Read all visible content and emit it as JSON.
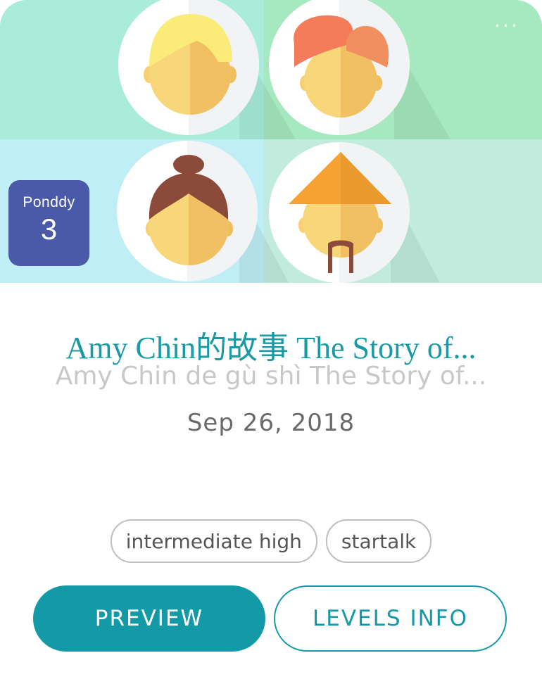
{
  "story": {
    "title": "Amy Chin的故事 The Story of...",
    "pinyin": "Amy Chin de gù shì The Story of...",
    "date": "Sep 26, 2018"
  },
  "badge": {
    "brand": "Ponddy",
    "level": "3"
  },
  "menu": {
    "more_label": "···"
  },
  "tags": [
    "intermediate high",
    "startalk"
  ],
  "actions": {
    "preview_label": "PREVIEW",
    "levels_label": "LEVELS INFO"
  },
  "colors": {
    "accent": "#139aa6",
    "badge": "#4a5aa8",
    "tile_top_left": "#a8ecd9",
    "tile_top_right": "#a6e8bf",
    "tile_bottom_left": "#bfeef5",
    "tile_bottom_right": "#c0ebdd"
  },
  "illustration": {
    "characters": [
      "blonde-person-icon",
      "turban-person-icon",
      "bun-hair-person-icon",
      "straw-hat-person-icon"
    ]
  }
}
